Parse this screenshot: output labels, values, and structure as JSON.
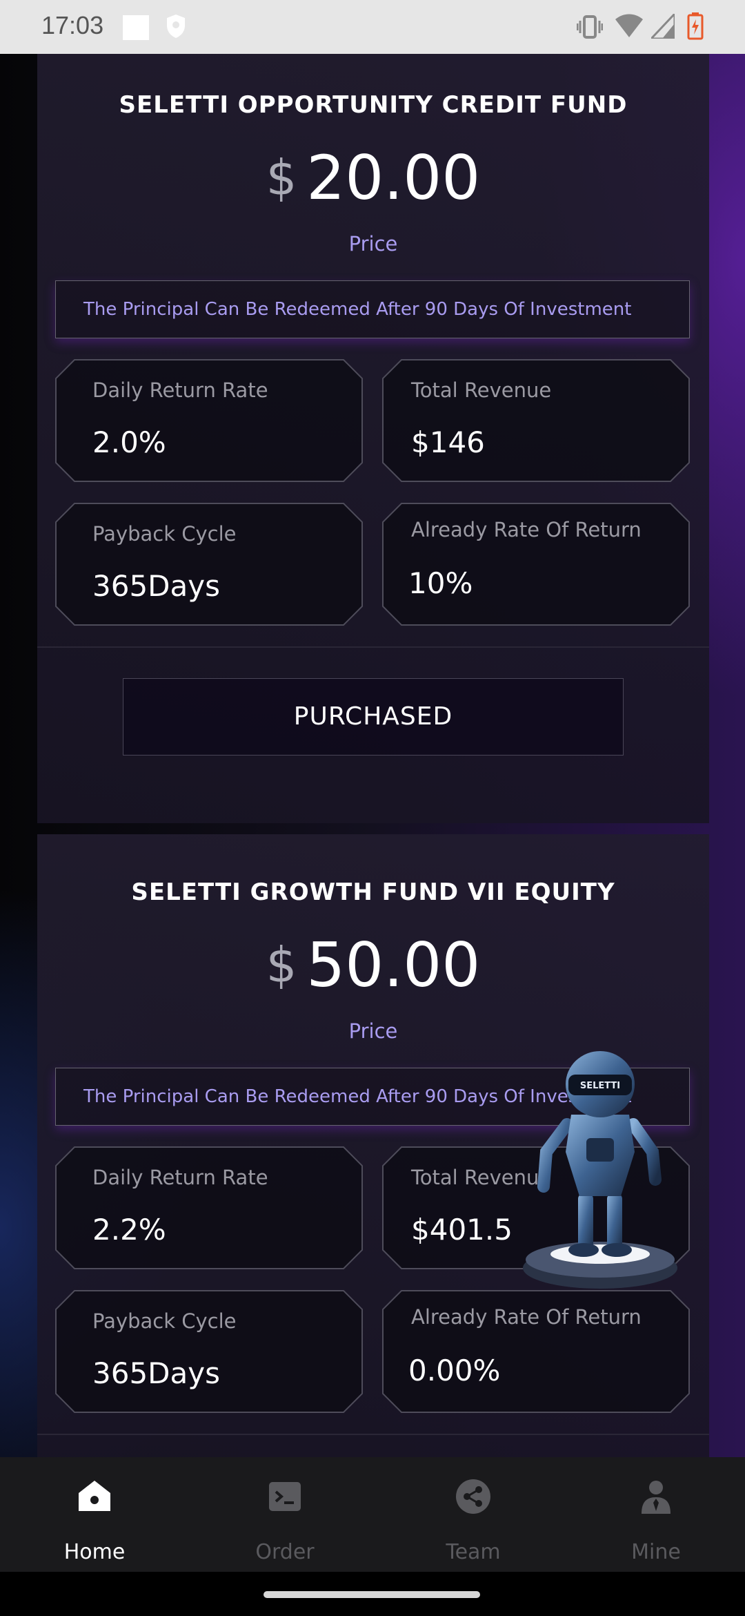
{
  "status_bar": {
    "time": "17:03",
    "icons": [
      "notification-square-icon",
      "shield-icon",
      "vibrate-icon",
      "wifi-icon",
      "signal-icon",
      "battery-charging-icon"
    ]
  },
  "products": [
    {
      "title": "SELETTI OPPORTUNITY CREDIT FUND",
      "currency": "$",
      "price": "20.00",
      "price_label": "Price",
      "notice": "The Principal Can Be Redeemed After 90 Days Of Investment",
      "stats": [
        {
          "label": "Daily Return Rate",
          "value": "2.0%"
        },
        {
          "label": "Total Revenue",
          "value": "$146"
        },
        {
          "label": "Payback Cycle",
          "value": "365Days"
        },
        {
          "label": "Already Rate Of Return",
          "value": "10%"
        }
      ],
      "button_label": "PURCHASED"
    },
    {
      "title": "SELETTI GROWTH FUND VII EQUITY",
      "currency": "$",
      "price": "50.00",
      "price_label": "Price",
      "notice": "The Principal Can Be Redeemed After 90 Days Of Investment",
      "stats": [
        {
          "label": "Daily Return Rate",
          "value": "2.2%"
        },
        {
          "label": "Total Revenue",
          "value": "$401.5"
        },
        {
          "label": "Payback Cycle",
          "value": "365Days"
        },
        {
          "label": "Already Rate Of Return",
          "value": "0.00%"
        }
      ]
    }
  ],
  "robot": {
    "badge_text": "SELETTI"
  },
  "nav": {
    "active_color": "#ffffff",
    "inactive_color": "#5a5a5e",
    "items": [
      {
        "label": "Home",
        "icon": "home-icon",
        "active": true
      },
      {
        "label": "Order",
        "icon": "terminal-icon",
        "active": false
      },
      {
        "label": "Team",
        "icon": "share-icon",
        "active": false
      },
      {
        "label": "Mine",
        "icon": "person-icon",
        "active": false
      }
    ]
  }
}
